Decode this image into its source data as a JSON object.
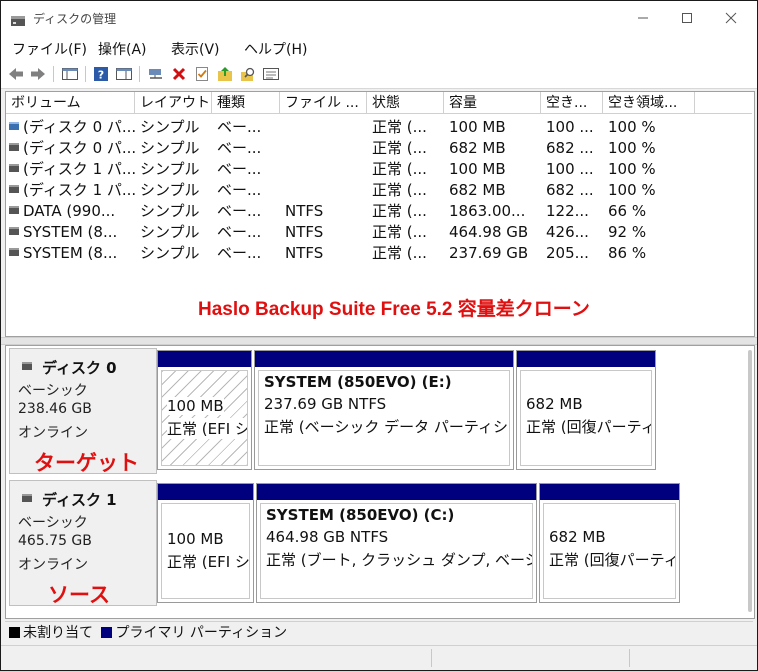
{
  "window": {
    "title": "ディスクの管理"
  },
  "menu": [
    "ファイル(F)",
    "操作(A)",
    "表示(V)",
    "ヘルプ(H)"
  ],
  "toolbar_icons": [
    "back-icon",
    "forward-icon",
    "console-tree-icon",
    "help-icon",
    "properties-pane-icon",
    "connect-icon",
    "delete-icon",
    "checklist-icon",
    "folder-up-icon",
    "search-icon",
    "properties-icon"
  ],
  "table": {
    "headers": [
      "ボリューム",
      "レイアウト",
      "種類",
      "ファイル ...",
      "状態",
      "容量",
      "空き...",
      "空き領域..."
    ],
    "rows": [
      {
        "vol": "(ディスク 0 パ...",
        "layout": "シンプル",
        "type": "ベー...",
        "fs": "",
        "status": "正常 (...",
        "cap": "100 MB",
        "free": "100 ...",
        "pct": "100 %",
        "icon": "blue"
      },
      {
        "vol": "(ディスク 0 パ...",
        "layout": "シンプル",
        "type": "ベー...",
        "fs": "",
        "status": "正常 (...",
        "cap": "682 MB",
        "free": "682 ...",
        "pct": "100 %",
        "icon": "gray"
      },
      {
        "vol": "(ディスク 1 パ...",
        "layout": "シンプル",
        "type": "ベー...",
        "fs": "",
        "status": "正常 (...",
        "cap": "100 MB",
        "free": "100 ...",
        "pct": "100 %",
        "icon": "gray"
      },
      {
        "vol": "(ディスク 1 パ...",
        "layout": "シンプル",
        "type": "ベー...",
        "fs": "",
        "status": "正常 (...",
        "cap": "682 MB",
        "free": "682 ...",
        "pct": "100 %",
        "icon": "gray"
      },
      {
        "vol": "DATA (990...",
        "layout": "シンプル",
        "type": "ベー...",
        "fs": "NTFS",
        "status": "正常 (...",
        "cap": "1863.00...",
        "free": "122...",
        "pct": "66 %",
        "icon": "gray"
      },
      {
        "vol": "SYSTEM (8...",
        "layout": "シンプル",
        "type": "ベー...",
        "fs": "NTFS",
        "status": "正常 (...",
        "cap": "464.98 GB",
        "free": "426...",
        "pct": "92 %",
        "icon": "gray"
      },
      {
        "vol": "SYSTEM (8...",
        "layout": "シンプル",
        "type": "ベー...",
        "fs": "NTFS",
        "status": "正常 (...",
        "cap": "237.69 GB",
        "free": "205...",
        "pct": "86 %",
        "icon": "gray"
      }
    ]
  },
  "annotation": "Haslo Backup Suite Free 5.2 容量差クローン",
  "disks": [
    {
      "name": "ディスク 0",
      "kind": "ベーシック",
      "size": "238.46 GB",
      "status": "オンライン",
      "tag": "ターゲット",
      "partitions": [
        {
          "title": "",
          "size": "100 MB",
          "status": "正常 (EFI シ"
        },
        {
          "title": "SYSTEM (850EVO)  (E:)",
          "size": "237.69 GB NTFS",
          "status": "正常 (ベーシック データ パーティション)"
        },
        {
          "title": "",
          "size": "682 MB",
          "status": "正常 (回復パーティ"
        }
      ]
    },
    {
      "name": "ディスク 1",
      "kind": "ベーシック",
      "size": "465.75 GB",
      "status": "オンライン",
      "tag": "ソース",
      "partitions": [
        {
          "title": "",
          "size": "100 MB",
          "status": "正常 (EFI シ"
        },
        {
          "title": "SYSTEM (850EVO)  (C:)",
          "size": "464.98 GB NTFS",
          "status": "正常 (ブート, クラッシュ ダンプ, ベーシック デ"
        },
        {
          "title": "",
          "size": "682 MB",
          "status": "正常 (回復パーティ"
        }
      ]
    }
  ],
  "legend": {
    "unallocated": "未割り当て",
    "primary": "プライマリ パーティション"
  },
  "colors": {
    "partition_bar": "#00007f",
    "annotation_red": "#e01010"
  }
}
